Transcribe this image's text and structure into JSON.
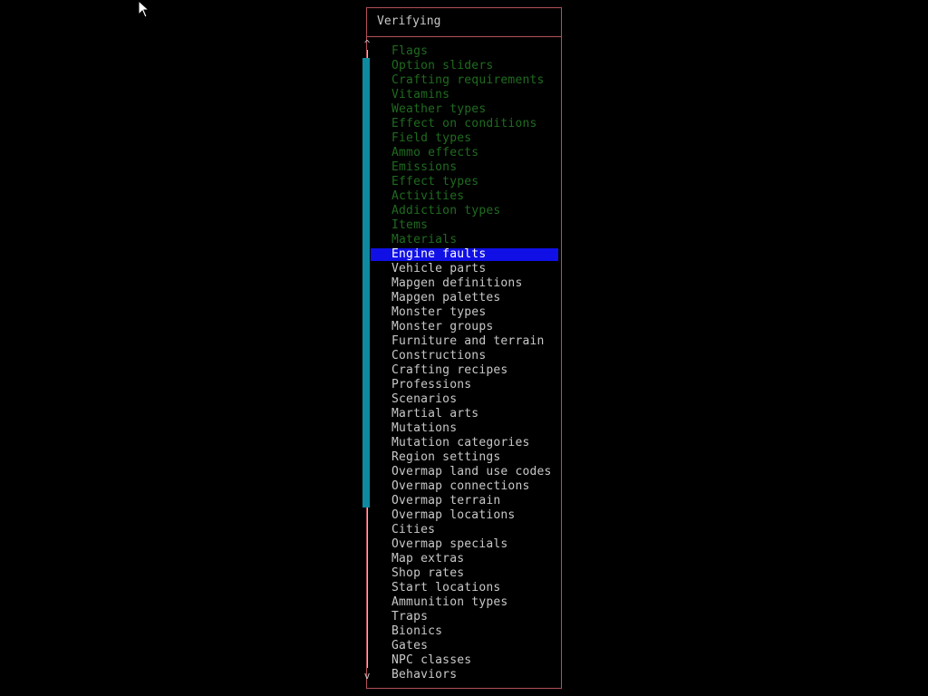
{
  "dialog": {
    "title": "Verifying",
    "scroll_up_glyph": "^",
    "scroll_down_glyph": "v",
    "current_index": 14,
    "completed_count": 14,
    "items": [
      {
        "label": "Flags",
        "status": "done"
      },
      {
        "label": "Option sliders",
        "status": "done"
      },
      {
        "label": "Crafting requirements",
        "status": "done"
      },
      {
        "label": "Vitamins",
        "status": "done"
      },
      {
        "label": "Weather types",
        "status": "done"
      },
      {
        "label": "Effect on conditions",
        "status": "done"
      },
      {
        "label": "Field types",
        "status": "done"
      },
      {
        "label": "Ammo effects",
        "status": "done"
      },
      {
        "label": "Emissions",
        "status": "done"
      },
      {
        "label": "Effect types",
        "status": "done"
      },
      {
        "label": "Activities",
        "status": "done"
      },
      {
        "label": "Addiction types",
        "status": "done"
      },
      {
        "label": "Items",
        "status": "done"
      },
      {
        "label": "Materials",
        "status": "done"
      },
      {
        "label": "Engine faults",
        "status": "current"
      },
      {
        "label": "Vehicle parts",
        "status": "pending"
      },
      {
        "label": "Mapgen definitions",
        "status": "pending"
      },
      {
        "label": "Mapgen palettes",
        "status": "pending"
      },
      {
        "label": "Monster types",
        "status": "pending"
      },
      {
        "label": "Monster groups",
        "status": "pending"
      },
      {
        "label": "Furniture and terrain",
        "status": "pending"
      },
      {
        "label": "Constructions",
        "status": "pending"
      },
      {
        "label": "Crafting recipes",
        "status": "pending"
      },
      {
        "label": "Professions",
        "status": "pending"
      },
      {
        "label": "Scenarios",
        "status": "pending"
      },
      {
        "label": "Martial arts",
        "status": "pending"
      },
      {
        "label": "Mutations",
        "status": "pending"
      },
      {
        "label": "Mutation categories",
        "status": "pending"
      },
      {
        "label": "Region settings",
        "status": "pending"
      },
      {
        "label": "Overmap land use codes",
        "status": "pending"
      },
      {
        "label": "Overmap connections",
        "status": "pending"
      },
      {
        "label": "Overmap terrain",
        "status": "pending"
      },
      {
        "label": "Overmap locations",
        "status": "pending"
      },
      {
        "label": "Cities",
        "status": "pending"
      },
      {
        "label": "Overmap specials",
        "status": "pending"
      },
      {
        "label": "Map extras",
        "status": "pending"
      },
      {
        "label": "Shop rates",
        "status": "pending"
      },
      {
        "label": "Start locations",
        "status": "pending"
      },
      {
        "label": "Ammunition types",
        "status": "pending"
      },
      {
        "label": "Traps",
        "status": "pending"
      },
      {
        "label": "Bionics",
        "status": "pending"
      },
      {
        "label": "Gates",
        "status": "pending"
      },
      {
        "label": "NPC classes",
        "status": "pending"
      },
      {
        "label": "Behaviors",
        "status": "pending"
      }
    ]
  },
  "colors": {
    "background": "#000000",
    "border": "#b4505a",
    "text_pending": "#c8c8c8",
    "text_done": "#1f6b1f",
    "highlight": "#1010e6",
    "scrollbar_thumb": "#0e8aa0"
  },
  "icons": {
    "cursor": "mouse-pointer-icon"
  }
}
